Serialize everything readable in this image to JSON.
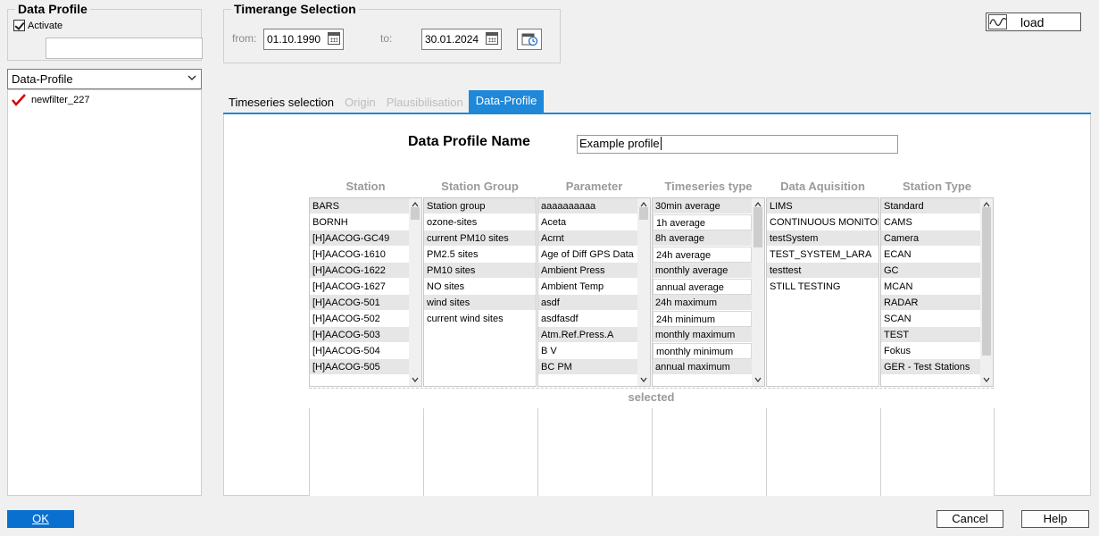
{
  "left_panel": {
    "group_title": "Data Profile",
    "activate_label": "Activate",
    "dropdown_value": "Data-Profile",
    "tree_item": "newfilter_227"
  },
  "timerange": {
    "title": "Timerange Selection",
    "from_label": "from:",
    "from_value": "01.10.1990",
    "to_label": "to:",
    "to_value": "30.01.2024"
  },
  "load_button": {
    "label": "load"
  },
  "tabs": [
    {
      "label": "Timeseries selection",
      "state": "normal"
    },
    {
      "label": "Origin",
      "state": "disabled"
    },
    {
      "label": "Plausibilisation",
      "state": "disabled"
    },
    {
      "label": "Data-Profile",
      "state": "active"
    }
  ],
  "profile": {
    "name_label": "Data Profile Name",
    "name_value": "Example profile"
  },
  "columns": [
    {
      "header": "Station",
      "items": [
        "BARS",
        "BORNH",
        "[H]AACOG-GC49",
        "[H]AACOG-1610",
        "[H]AACOG-1622",
        "[H]AACOG-1627",
        "[H]AACOG-501",
        "[H]AACOG-502",
        "[H]AACOG-503",
        "[H]AACOG-504",
        "[H]AACOG-505"
      ]
    },
    {
      "header": "Station Group",
      "items": [
        "Station group",
        "ozone-sites",
        "current PM10 sites",
        "PM2.5 sites",
        "PM10 sites",
        "NO sites",
        "wind sites",
        "current wind sites"
      ]
    },
    {
      "header": "Parameter",
      "items": [
        "aaaaaaaaaa",
        "Aceta",
        "Acrnt",
        "Age of Diff GPS Data",
        "Ambient Press",
        "Ambient Temp",
        "asdf",
        "asdfasdf",
        "Atm.Ref.Press.A",
        "B V",
        "BC PM"
      ]
    },
    {
      "header": "Timeseries type",
      "items": [
        "30min average",
        "1h average",
        "8h average",
        "24h average",
        "monthly average",
        "annual average",
        "24h maximum",
        "24h minimum",
        "monthly maximum",
        "monthly minimum",
        "annual maximum"
      ]
    },
    {
      "header": "Data Aquisition",
      "items": [
        "LIMS",
        "CONTINUOUS MONITORING",
        "testSystem",
        "TEST_SYSTEM_LARA",
        "testtest",
        "STILL TESTING"
      ]
    },
    {
      "header": "Station Type",
      "items": [
        "Standard",
        "CAMS",
        "Camera",
        "ECAN",
        "GC",
        "MCAN",
        "RADAR",
        "SCAN",
        "TEST",
        "Fokus",
        "GER - Test Stations"
      ]
    }
  ],
  "selected_label": "selected",
  "footer": {
    "ok_label": "OK",
    "cancel_label": "Cancel",
    "help_label": "Help"
  }
}
